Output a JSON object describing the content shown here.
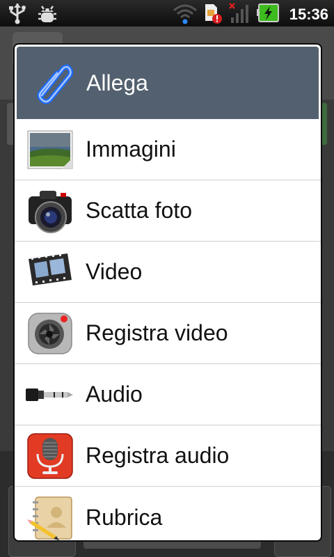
{
  "status_bar": {
    "time": "15:36",
    "left_icons": [
      "usb-icon",
      "debug-bug-icon"
    ],
    "right_icons": [
      "wifi-icon",
      "sim-alert-icon",
      "no-signal-icon",
      "battery-charging-icon"
    ]
  },
  "dialog": {
    "title": "Allega",
    "title_icon": "paperclip-icon",
    "items": [
      {
        "label": "Immagini",
        "icon": "image-gallery-icon"
      },
      {
        "label": "Scatta foto",
        "icon": "camera-icon"
      },
      {
        "label": "Video",
        "icon": "film-strip-icon"
      },
      {
        "label": "Registra video",
        "icon": "video-camera-record-icon"
      },
      {
        "label": "Audio",
        "icon": "audio-jack-icon"
      },
      {
        "label": "Registra audio",
        "icon": "microphone-icon"
      },
      {
        "label": "Rubrica",
        "icon": "contacts-notebook-icon"
      }
    ]
  },
  "colors": {
    "header_bg": "#53606f",
    "dialog_bg": "#ffffff",
    "divider": "#cfcfcf",
    "status_bar_bg": "#000000",
    "battery_green": "#3dbb1f"
  }
}
